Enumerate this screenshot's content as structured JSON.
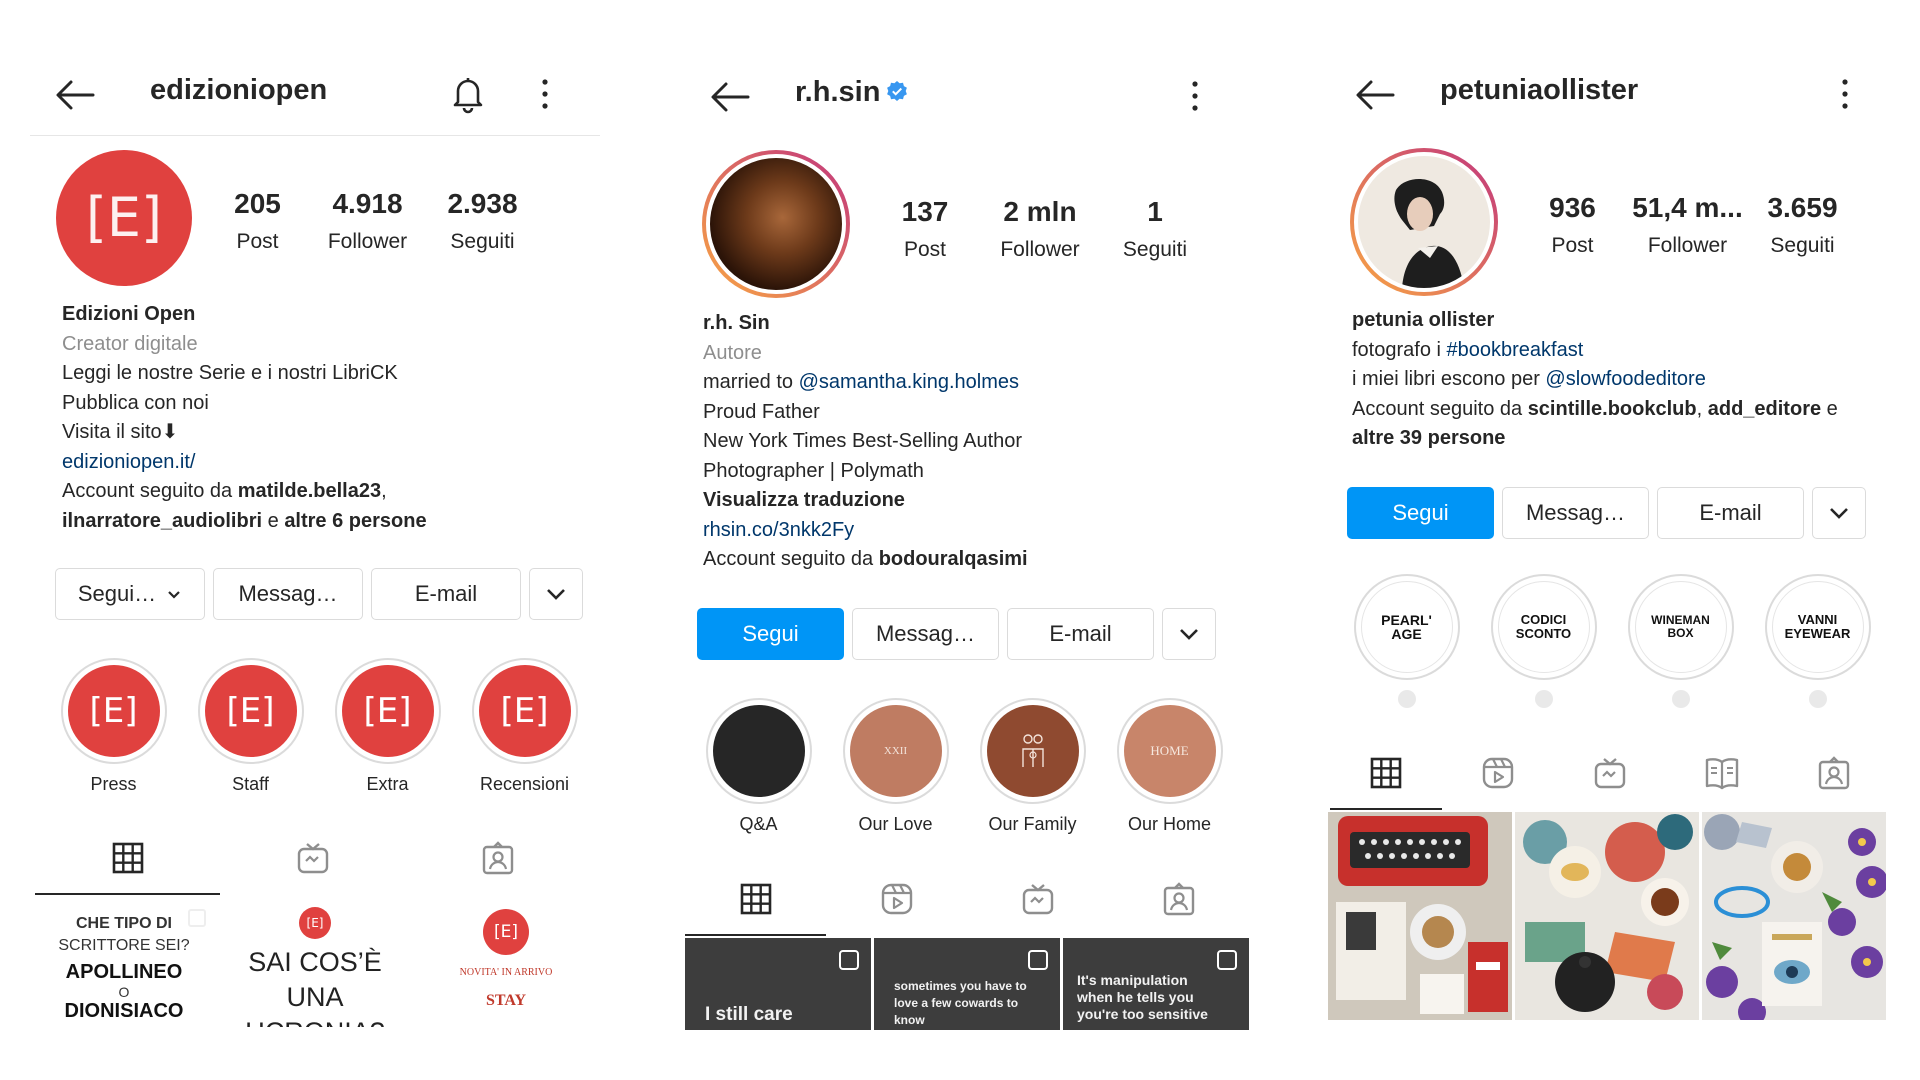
{
  "profiles": [
    {
      "username": "edizioniopen",
      "stats": [
        {
          "num": "205",
          "label": "Post"
        },
        {
          "num": "4.918",
          "label": "Follower"
        },
        {
          "num": "2.938",
          "label": "Seguiti"
        }
      ],
      "bio": {
        "name": "Edizioni Open",
        "category": "Creator digitale",
        "line1": "Leggi le nostre Serie e i nostri LibriCK",
        "line2": "Pubblica con noi",
        "line3": "Visita il sito⬇",
        "link": "edizioniopen.it/",
        "followed_prefix": "Account seguito da ",
        "followed_user1": "matilde.bella23",
        "followed_comma": ",",
        "followed_user2": "ilnarratore_audiolibri",
        "followed_and": " e ",
        "followed_others": "altre 6 persone"
      },
      "buttons": {
        "follow": "Segui…",
        "message": "Messag…",
        "email": "E-mail"
      },
      "highlights": [
        {
          "label": "Press",
          "glyph": "[E]"
        },
        {
          "label": "Staff",
          "glyph": "[E]"
        },
        {
          "label": "Extra",
          "glyph": "[E]"
        },
        {
          "label": "Recensioni",
          "glyph": "[E]"
        }
      ],
      "posts": [
        {
          "l1": "CHE TIPO DI",
          "l2": "SCRITTORE SEI?",
          "l3": "APOLLINEO",
          "l4": "O",
          "l5": "DIONISIACO"
        },
        {
          "l1": "SAI COS’È",
          "l2": "UNA",
          "l3": "UCRONIA?",
          "logo": "[E]"
        },
        {
          "l1": "NOVITA' IN ARRIVO",
          "l2": "STAY",
          "logo": "[E]"
        }
      ]
    },
    {
      "username": "r.h.sin",
      "stats": [
        {
          "num": "137",
          "label": "Post"
        },
        {
          "num": "2 mln",
          "label": "Follower"
        },
        {
          "num": "1",
          "label": "Seguiti"
        }
      ],
      "bio": {
        "name": "r.h. Sin",
        "category": "Autore",
        "married_prefix": "married to ",
        "married_link": "@samantha.king.holmes",
        "line2": "Proud Father",
        "line3": "New York Times Best-Selling Author",
        "line4": "Photographer | Polymath",
        "translate": "Visualizza traduzione",
        "link": "rhsin.co/3nkk2Fy",
        "followed_prefix": "Account seguito da ",
        "followed_user1": "bodouralqasimi"
      },
      "buttons": {
        "follow": "Segui",
        "message": "Messag…",
        "email": "E-mail"
      },
      "highlights": [
        {
          "label": "Q&A",
          "glyph": ""
        },
        {
          "label": "Our Love",
          "glyph": "XXII"
        },
        {
          "label": "Our Family",
          "glyph": ""
        },
        {
          "label": "Our Home",
          "glyph": "HOME"
        }
      ],
      "posts": [
        {
          "text": "I still care"
        },
        {
          "text": "sometimes you have to love a few cowards to know"
        },
        {
          "text": "It's manipulation when he tells you you're too sensitive"
        }
      ]
    },
    {
      "username": "petuniaollister",
      "stats": [
        {
          "num": "936",
          "label": "Post"
        },
        {
          "num": "51,4 m...",
          "label": "Follower"
        },
        {
          "num": "3.659",
          "label": "Seguiti"
        }
      ],
      "bio": {
        "name": "petunia ollister",
        "line1_prefix": "fotografo i ",
        "line1_tag": "#bookbreakfast",
        "line2_prefix": "i miei libri escono per ",
        "line2_link": "@slowfoodeditore",
        "followed_prefix": "Account seguito da ",
        "followed_user1": "scintille.bookclub",
        "followed_comma": ", ",
        "followed_user2": "add_editore",
        "followed_and": " e",
        "followed_others": "altre 39 persone"
      },
      "buttons": {
        "follow": "Segui",
        "message": "Messag…",
        "email": "E-mail"
      },
      "highlights": [
        {
          "label": "",
          "glyph": "PEARL' AGE"
        },
        {
          "label": "",
          "glyph": "CODICI SCONTO"
        },
        {
          "label": "",
          "glyph": "WINEMAN BOX"
        },
        {
          "label": "",
          "glyph": "VANNI EYEWEAR"
        }
      ]
    }
  ],
  "colors": {
    "blue_button": "#0095f6",
    "link": "#00376b",
    "verified": "#3897f0",
    "edizioni_red": "#e0413f",
    "muted": "#8e8e8e"
  }
}
